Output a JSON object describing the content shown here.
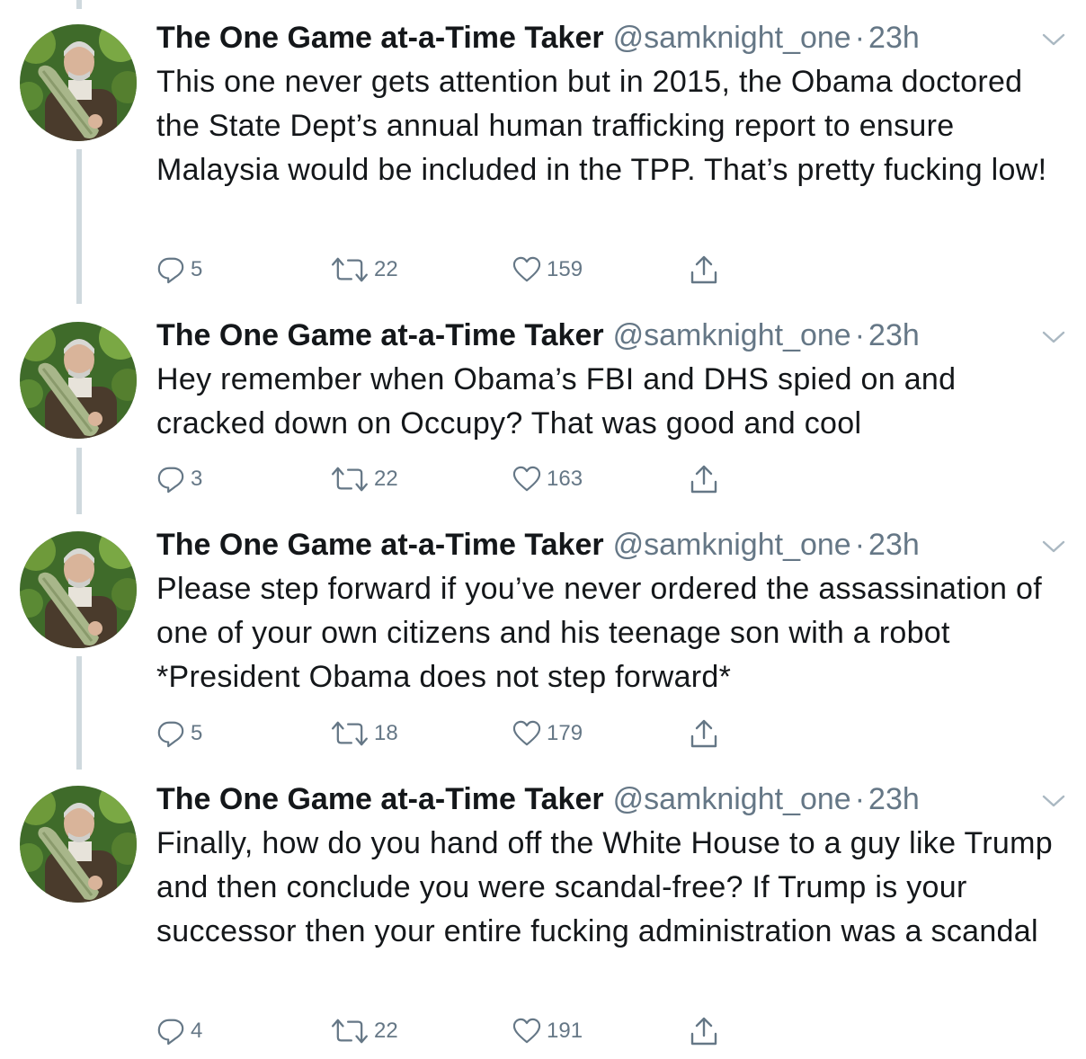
{
  "colors": {
    "text": "#14171a",
    "secondary": "#657786",
    "thread_line": "#cfd9de"
  },
  "tweets": [
    {
      "name": "The One Game at-a-Time Taker",
      "handle": "@samknight_one",
      "separator": "·",
      "time": "23h",
      "text": "This one never gets attention but in 2015, the Obama doctored the State Dept’s annual human trafficking report to ensure Malaysia would be included in the TPP. That’s pretty fucking low!",
      "replies": "5",
      "retweets": "22",
      "likes": "159"
    },
    {
      "name": "The One Game at-a-Time Taker",
      "handle": "@samknight_one",
      "separator": "·",
      "time": "23h",
      "text": "Hey remember when Obama’s FBI and DHS spied on and cracked down on Occupy? That was good and cool",
      "replies": "3",
      "retweets": "22",
      "likes": "163"
    },
    {
      "name": "The One Game at-a-Time Taker",
      "handle": "@samknight_one",
      "separator": "·",
      "time": "23h",
      "text": "Please step forward if you’ve never ordered the assassination of one of your own citizens and his teenage son with a robot *President Obama does not step forward*",
      "replies": "5",
      "retweets": "18",
      "likes": "179"
    },
    {
      "name": "The One Game at-a-Time Taker",
      "handle": "@samknight_one",
      "separator": "·",
      "time": "23h",
      "text": "Finally, how do you hand off the White House to a guy like Trump and then conclude you were scandal-free?  If Trump is your successor then your entire fucking administration was a scandal",
      "replies": "4",
      "retweets": "22",
      "likes": "191"
    }
  ],
  "icons": {
    "avatar": "profile-photo",
    "caret": "chevron-down-icon",
    "reply": "reply-icon",
    "retweet": "retweet-icon",
    "like": "heart-icon",
    "share": "share-icon"
  }
}
